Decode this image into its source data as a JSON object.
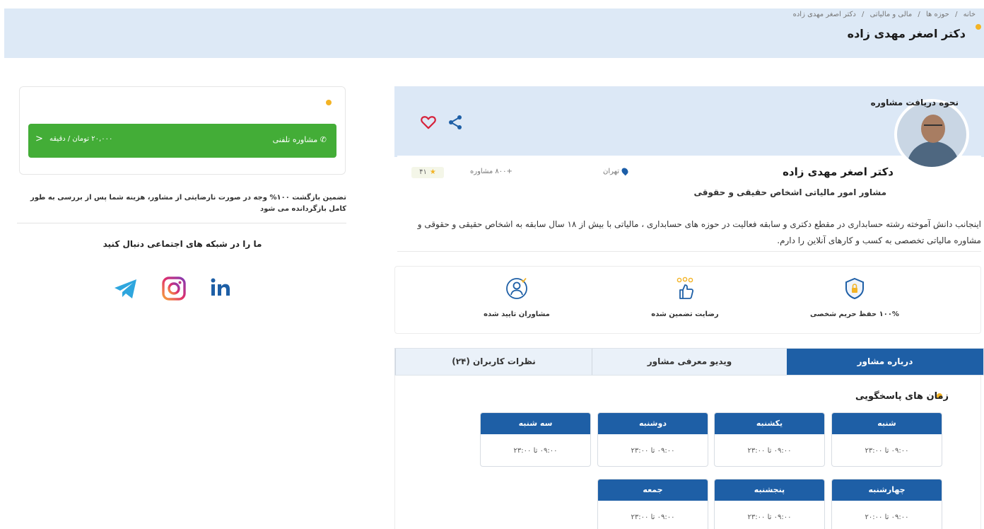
{
  "breadcrumb": [
    "خانه",
    "/",
    "حوزه ها",
    "/",
    "مالی و مالیاتی",
    "/",
    "دکتر اصغر مهدی زاده"
  ],
  "page_title": "دکتر اصغر مهدی زاده",
  "profile": {
    "name": "دکتر اصغر مهدی زاده",
    "subtitle": "مشاور امور مالیاتی اشخاص حقیقی و حقوقی",
    "city": "تهران",
    "consultations": "+۸۰۰ مشاوره",
    "rating": "۴۱",
    "bio": "اینجانب دانش آموخته رشته حسابداری در مقطع دکتری و سابقه فعالیت در حوزه های حسابداری ، مالیاتی با بیش از ۱۸ سال سابقه به اشخاص حقیقی و حقوقی و مشاوره مالیاتی تخصصی به کسب و کارهای آنلاین را دارم."
  },
  "features": [
    {
      "label": "۱۰۰% حفظ حریم شخصی",
      "icon": "shield-lock-icon"
    },
    {
      "label": "رضایت تضمین شده",
      "icon": "thumbs-up-stars-icon"
    },
    {
      "label": "مشاوران تایید شده",
      "icon": "verified-user-icon"
    }
  ],
  "tabs": [
    {
      "label": "درباره مشاور",
      "active": true
    },
    {
      "label": "ویدیو معرفی مشاور",
      "active": false
    },
    {
      "label": "نظرات کاربران (۲۴)",
      "active": false
    }
  ],
  "hours": {
    "title": "زمان های پاسخگویی",
    "days": [
      {
        "day": "شنبه",
        "time": "۰۹:۰۰ تا ۲۳:۰۰"
      },
      {
        "day": "یکشنبه",
        "time": "۰۹:۰۰ تا ۲۳:۰۰"
      },
      {
        "day": "دوشنبه",
        "time": "۰۹:۰۰ تا ۲۳:۰۰"
      },
      {
        "day": "سه شنبه",
        "time": "۰۹:۰۰ تا ۲۳:۰۰"
      },
      {
        "day": "چهارشنبه",
        "time": "۰۹:۰۰ تا ۲۰:۰۰"
      },
      {
        "day": "پنجشنبه",
        "time": "۰۹:۰۰ تا ۲۳:۰۰"
      },
      {
        "day": "جمعه",
        "time": "۰۹:۰۰ تا ۲۳:۰۰"
      }
    ]
  },
  "consult": {
    "title": "نحوه دریافت مشاوره",
    "type": "مشاوره تلفنی",
    "price": "۲۰,۰۰۰ تومان / دقیقه",
    "chevron": "<"
  },
  "guarantee": "تضمین بازگشت ۱۰۰% وجه در صورت نارضایتی از مشاور، هزینه شما پس از بررسی به طور کامل بازگردانده می شود",
  "social": {
    "title": "ما را در شبکه های اجتماعی دنبال کنید",
    "networks": [
      "linkedin-icon",
      "instagram-icon",
      "telegram-icon"
    ]
  },
  "colors": {
    "brand": "#1e5fa6",
    "accent": "#f3b325",
    "green": "#43ad37",
    "heart": "#d6213a"
  }
}
